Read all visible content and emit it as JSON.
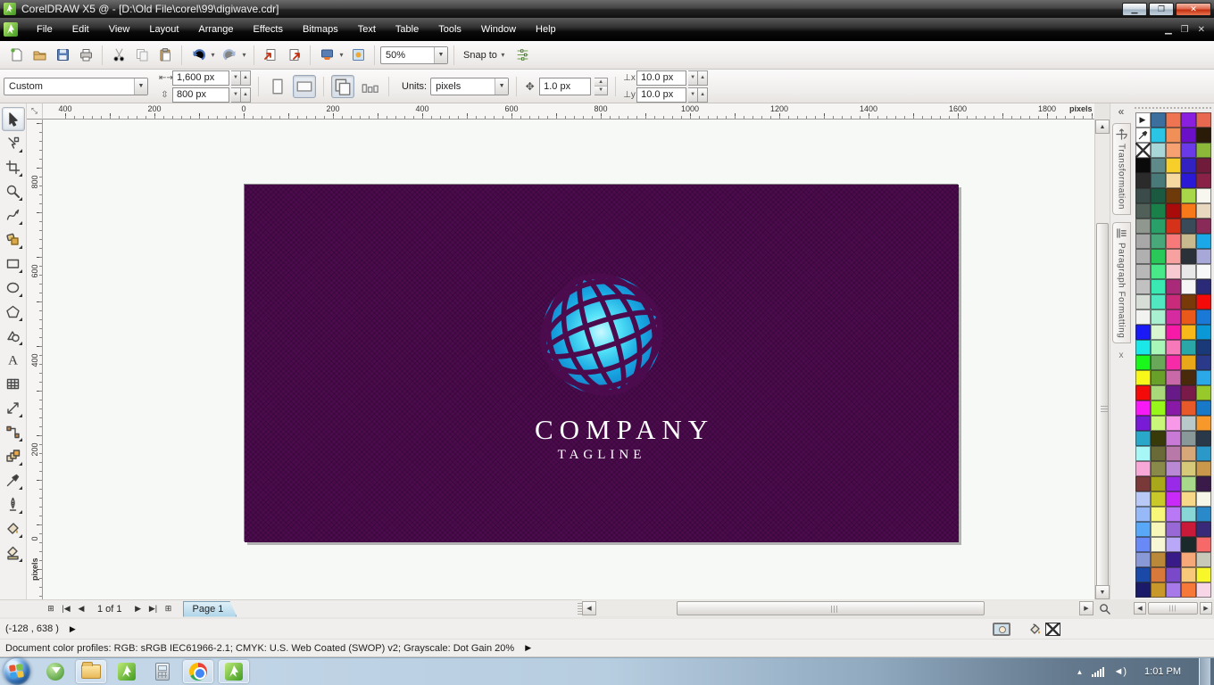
{
  "titlebar": {
    "title": "CorelDRAW X5 @ - [D:\\Old File\\corel\\99\\digiwave.cdr]"
  },
  "menus": [
    "File",
    "Edit",
    "View",
    "Layout",
    "Arrange",
    "Effects",
    "Bitmaps",
    "Text",
    "Table",
    "Tools",
    "Window",
    "Help"
  ],
  "toolbar": {
    "zoom_value": "50%",
    "snap_label": "Snap to"
  },
  "property_bar": {
    "preset": "Custom",
    "page_width": "1,600 px",
    "page_height": "800 px",
    "units_label": "Units:",
    "units": "pixels",
    "nudge": "1.0 px",
    "duplicate_x": "10.0 px",
    "duplicate_y": "10.0 px"
  },
  "rulers": {
    "h_labels": [
      [
        "400",
        25
      ],
      [
        "200",
        125
      ],
      [
        "0",
        225
      ],
      [
        "200",
        325
      ],
      [
        "400",
        425
      ],
      [
        "600",
        525
      ],
      [
        "800",
        625
      ],
      [
        "1000",
        725
      ],
      [
        "1200",
        825
      ],
      [
        "1400",
        925
      ],
      [
        "1600",
        1025
      ],
      [
        "1800",
        1125
      ]
    ],
    "h_unit": "pixels",
    "v_labels": [
      [
        "800",
        73
      ],
      [
        "600",
        173
      ],
      [
        "400",
        273
      ],
      [
        "200",
        373
      ],
      [
        "0",
        473
      ]
    ],
    "v_unit": "pixels"
  },
  "toolbox": [
    {
      "name": "pick-tool",
      "selected": true,
      "flyout": false
    },
    {
      "name": "shape-tool",
      "flyout": true
    },
    {
      "name": "crop-tool",
      "flyout": true
    },
    {
      "name": "zoom-tool",
      "flyout": true
    },
    {
      "name": "freehand-tool",
      "flyout": true
    },
    {
      "name": "smart-fill-tool",
      "flyout": true
    },
    {
      "name": "rectangle-tool",
      "flyout": true
    },
    {
      "name": "ellipse-tool",
      "flyout": true
    },
    {
      "name": "polygon-tool",
      "flyout": true
    },
    {
      "name": "basic-shapes-tool",
      "flyout": true
    },
    {
      "name": "text-tool",
      "flyout": false
    },
    {
      "name": "table-tool",
      "flyout": false
    },
    {
      "name": "dimension-tool",
      "flyout": true
    },
    {
      "name": "connector-tool",
      "flyout": true
    },
    {
      "name": "blend-tool",
      "flyout": true
    },
    {
      "name": "eyedropper-tool",
      "flyout": true
    },
    {
      "name": "outline-pen-tool",
      "flyout": true
    },
    {
      "name": "fill-tool",
      "flyout": true
    },
    {
      "name": "interactive-fill-tool",
      "flyout": true
    }
  ],
  "artboard": {
    "brand_name": "COMPANY",
    "brand_tagline": "TAGLINE",
    "page_color": "#4b0b4d",
    "logo_colors": {
      "center": "#c9f8ff",
      "mid": "#2fc3ee",
      "edge": "#1173c4"
    }
  },
  "dockers": {
    "tabs": [
      "Transformation",
      "Paragraph Formatting"
    ],
    "close_label": "x",
    "collapse_glyph": "«"
  },
  "palette": {
    "rows": [
      [
        "@arrow",
        "#3c6e9e",
        "#ef7552",
        "#8a1fe0",
        "#e86950"
      ],
      [
        "@dropper",
        "#2ac4e4",
        "#f09058",
        "#6b10c9",
        "#2a1a08"
      ],
      [
        "@none",
        "#a9d6d6",
        "#f7a172",
        "#6a39e8",
        "#8cb83a"
      ],
      [
        "#0a0a0a",
        "#5f8a89",
        "#f7cf2b",
        "#3222c1",
        "#6f1b39"
      ],
      [
        "#2b2b2b",
        "#497a79",
        "#f6d8a1",
        "#2a1ad6",
        "#8a2147"
      ],
      [
        "#3b4b49",
        "#1b5a41",
        "#6f3a0a",
        "#a8d74a",
        "#f7f7ef"
      ],
      [
        "#515f59",
        "#198049",
        "#a90a0a",
        "#f7791a",
        "#e8d8c0"
      ],
      [
        "#8f978f",
        "#2aa069",
        "#d63119",
        "#394a59",
        "#8a2a59"
      ],
      [
        "#a8a8a8",
        "#49a879",
        "#f77979",
        "#c9b98f",
        "#1aa8e8"
      ],
      [
        "#b0b0b0",
        "#2ac859",
        "#f7a1a1",
        "#2a3139",
        "#a8a8d8"
      ],
      [
        "#b8b8b8",
        "#49e889",
        "#f7c9d1",
        "#e8e8e8",
        "#f8f8f8"
      ],
      [
        "#c1c1c1",
        "#3ae8b1",
        "#a92a79",
        "#f5f5f5",
        "#2a2a79"
      ],
      [
        "#d6ded6",
        "#51e8c1",
        "#c92a79",
        "#793a0a",
        "#f50a0a"
      ],
      [
        "#f2f2f0",
        "#a9f0d1",
        "#d62aa1",
        "#e8591a",
        "#1a79d6"
      ],
      [
        "#1a1af7",
        "#d8f7d1",
        "#f71aa8",
        "#f7b91a",
        "#0a98d6"
      ],
      [
        "#1ae8e8",
        "#a8f7b9",
        "#f779b9",
        "#2aa8a8",
        "#1a3979"
      ],
      [
        "#1af71a",
        "#69a859",
        "#f72aa8",
        "#e8a81a",
        "#2a3989"
      ],
      [
        "#f7f71a",
        "#69a02a",
        "#c969a8",
        "#492a0a",
        "#2aa8e8"
      ],
      [
        "#f50a0a",
        "#a8d879",
        "#691a89",
        "#791a49",
        "#98c92a"
      ],
      [
        "#f71af7",
        "#98f71a",
        "#891aa8",
        "#e8592a",
        "#1979c9"
      ],
      [
        "#791ad6",
        "#c9f779",
        "#f798e8",
        "#b9c9c9",
        "#f7982a"
      ],
      [
        "#2aa8c9",
        "#393a0a",
        "#c979d6",
        "#899898",
        "#2a3949"
      ],
      [
        "#a8f7f7",
        "#6a6a39",
        "#b979a8",
        "#d6a879",
        "#2a98c9"
      ],
      [
        "#f7a8d6",
        "#898949",
        "#b989d6",
        "#d6c979",
        "#c9984a"
      ],
      [
        "#793939",
        "#a8a81a",
        "#982ae8",
        "#a8d889",
        "#391a49"
      ],
      [
        "#b9c9f7",
        "#c9c92a",
        "#c92af7",
        "#f7d889",
        "#f7f7e8"
      ],
      [
        "#98b9f7",
        "#f7f779",
        "#b979f7",
        "#89d6d6",
        "#2989c9"
      ],
      [
        "#59a8f7",
        "#f7f7b9",
        "#9869d6",
        "#c91a39",
        "#392a79"
      ],
      [
        "#6989f7",
        "#f7f7d6",
        "#b9a8f7",
        "#1a2a2a",
        "#f76969"
      ],
      [
        "#8998d6",
        "#b98939",
        "#391a89",
        "#f7a879",
        "#c9c9b9"
      ],
      [
        "#1a49a8",
        "#d6793a",
        "#7949c9",
        "#f7c979",
        "#f7f72a"
      ],
      [
        "#1a1a69",
        "#c9982a",
        "#a879e8",
        "#f7793a",
        "#f7d6e8"
      ]
    ]
  },
  "pagenav": {
    "count": "1 of 1",
    "tab": "Page 1"
  },
  "status": {
    "coords": "(-128 , 638  )",
    "profiles": "Document color profiles: RGB: sRGB IEC61966-2.1; CMYK: U.S. Web Coated (SWOP) v2; Grayscale: Dot Gain 20%",
    "outline_color": "#000000"
  },
  "taskbar": {
    "clock": "1:01 PM"
  }
}
